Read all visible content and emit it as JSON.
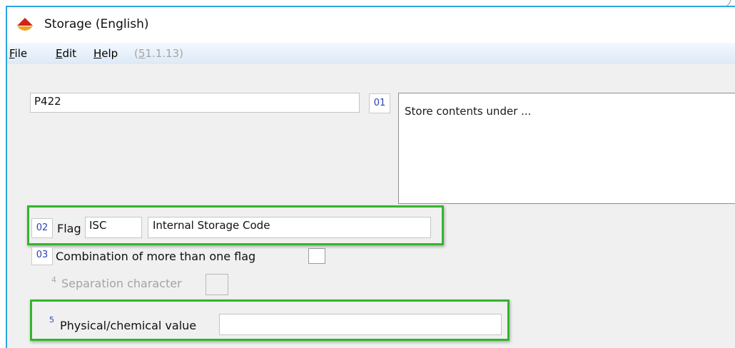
{
  "window": {
    "title": "Storage (English)"
  },
  "menu": {
    "file": {
      "mnemonic": "F",
      "rest": "ile"
    },
    "edit": {
      "mnemonic": "E",
      "rest": "dit"
    },
    "help": {
      "mnemonic": "H",
      "rest": "elp"
    },
    "version": {
      "open": "(",
      "mnemonic": "5",
      "rest": "1.1.13)"
    }
  },
  "form": {
    "code_value": "P422",
    "btn01": "01",
    "description": "Store contents under ...",
    "btn02": "02",
    "flag_label": "Flag",
    "flag_code": "ISC",
    "flag_name": "Internal Storage Code",
    "btn03": "03",
    "combination_label": "Combination of more than one flag",
    "combination_checked": false,
    "sep_num": "4",
    "sep_label": "Separation character",
    "phys_num": "5",
    "phys_label": "Physical/chemical value",
    "phys_value": ""
  },
  "colors": {
    "highlight": "#33b52c",
    "accent_blue": "#2b3fb5",
    "window_border": "#2aa6de",
    "icon_red": "#d1231c",
    "icon_orange": "#f2a11c"
  },
  "icons": {
    "app": "storage-app-icon"
  }
}
